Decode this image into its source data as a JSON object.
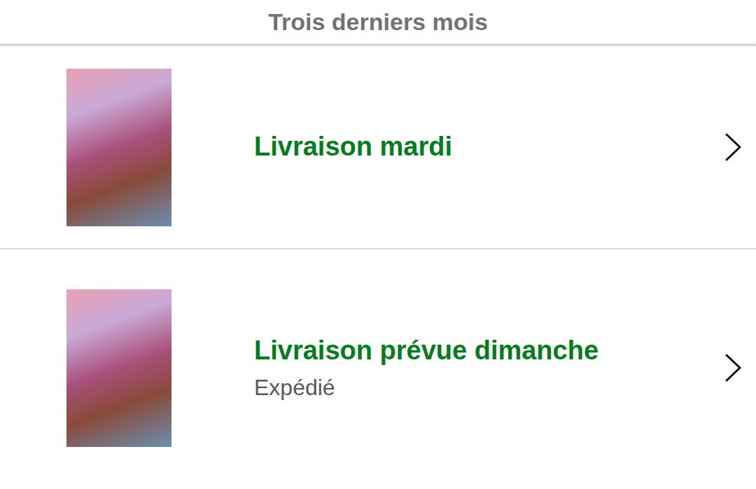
{
  "header": {
    "title": "Trois derniers mois"
  },
  "orders": [
    {
      "status": "Livraison mardi",
      "detail": ""
    },
    {
      "status": "Livraison prévue dimanche",
      "detail": "Expédié"
    }
  ]
}
